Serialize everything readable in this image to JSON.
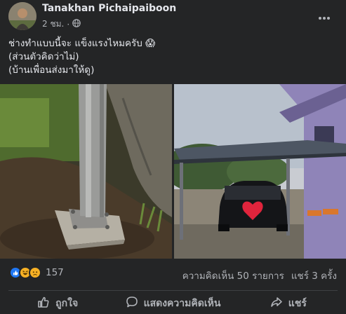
{
  "post": {
    "author": "Tanakhan Pichaipaiboon",
    "time": "2 ชม.",
    "privacy_icon": "globe-icon",
    "more_icon": "more-dots-icon",
    "text_lines": [
      "ช่างทำแบบนี้จะ แข็งแรงไหมครับ 😱",
      "(ส่วนตัวคิดว่าไม่)",
      "(บ้านเพื่อนส่งมาให้ดู)"
    ]
  },
  "photos": [
    {
      "name": "steel-post-base-photo"
    },
    {
      "name": "carport-car-photo"
    }
  ],
  "stats": {
    "reaction_icons": [
      "like-icon",
      "haha-icon",
      "sad-icon"
    ],
    "reaction_count": "157",
    "comments": "ความคิดเห็น 50 รายการ",
    "shares": "แชร์ 3 ครั้ง"
  },
  "actions": {
    "like": "ถูกใจ",
    "comment": "แสดงความคิดเห็น",
    "share": "แชร์"
  },
  "colors": {
    "background": "#242526",
    "text": "#e4e6eb",
    "secondary": "#b0b3b8",
    "like_blue": "#2078f4",
    "reaction_yellow": "#f7b125"
  }
}
